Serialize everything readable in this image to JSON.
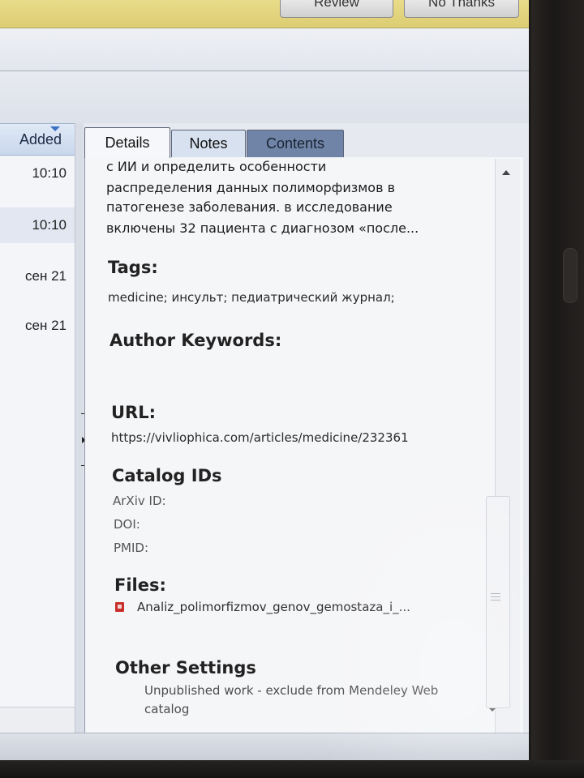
{
  "top_bar": {
    "review_label": "Review",
    "no_thanks_label": "No Thanks"
  },
  "list": {
    "column_header": "Added",
    "rows": [
      {
        "added": "10:10"
      },
      {
        "added": "10:10"
      },
      {
        "added": "сен 21"
      },
      {
        "added": "сен 21"
      }
    ]
  },
  "tabs": [
    {
      "label": "Details",
      "active": true
    },
    {
      "label": "Notes",
      "active": false
    },
    {
      "label": "Contents",
      "active": false
    }
  ],
  "details": {
    "abstract_lines": [
      "с ИИ и определить особенности",
      "распределения данных полиморфизмов в",
      "патогенезе заболевания. в исследование",
      "включены 32 пациента с диагнозом «после..."
    ],
    "tags_heading": "Tags:",
    "tags_value": "medicine; инсульт; педиатрический журнал;",
    "author_keywords_heading": "Author Keywords:",
    "url_heading": "URL:",
    "url_value": "https://vivliophica.com/articles/medicine/232361",
    "catalog_heading": "Catalog IDs",
    "catalog_ids": [
      {
        "label": "ArXiv ID:"
      },
      {
        "label": "DOI:"
      },
      {
        "label": "PMID:"
      }
    ],
    "files_heading": "Files:",
    "file_name": "Analiz_polimorfizmov_genov_gemostaza_i_...",
    "file_icon": "pdf-file-icon",
    "other_settings_heading": "Other Settings",
    "other_settings_lines": [
      "Unpublished work - exclude from Mendeley Web",
      "catalog"
    ]
  },
  "colors": {
    "top_bar": "#dccd72",
    "active_tab": "#f6f7fa",
    "contents_tab": "#6f84a6",
    "pdf_icon": "#c9302c"
  }
}
